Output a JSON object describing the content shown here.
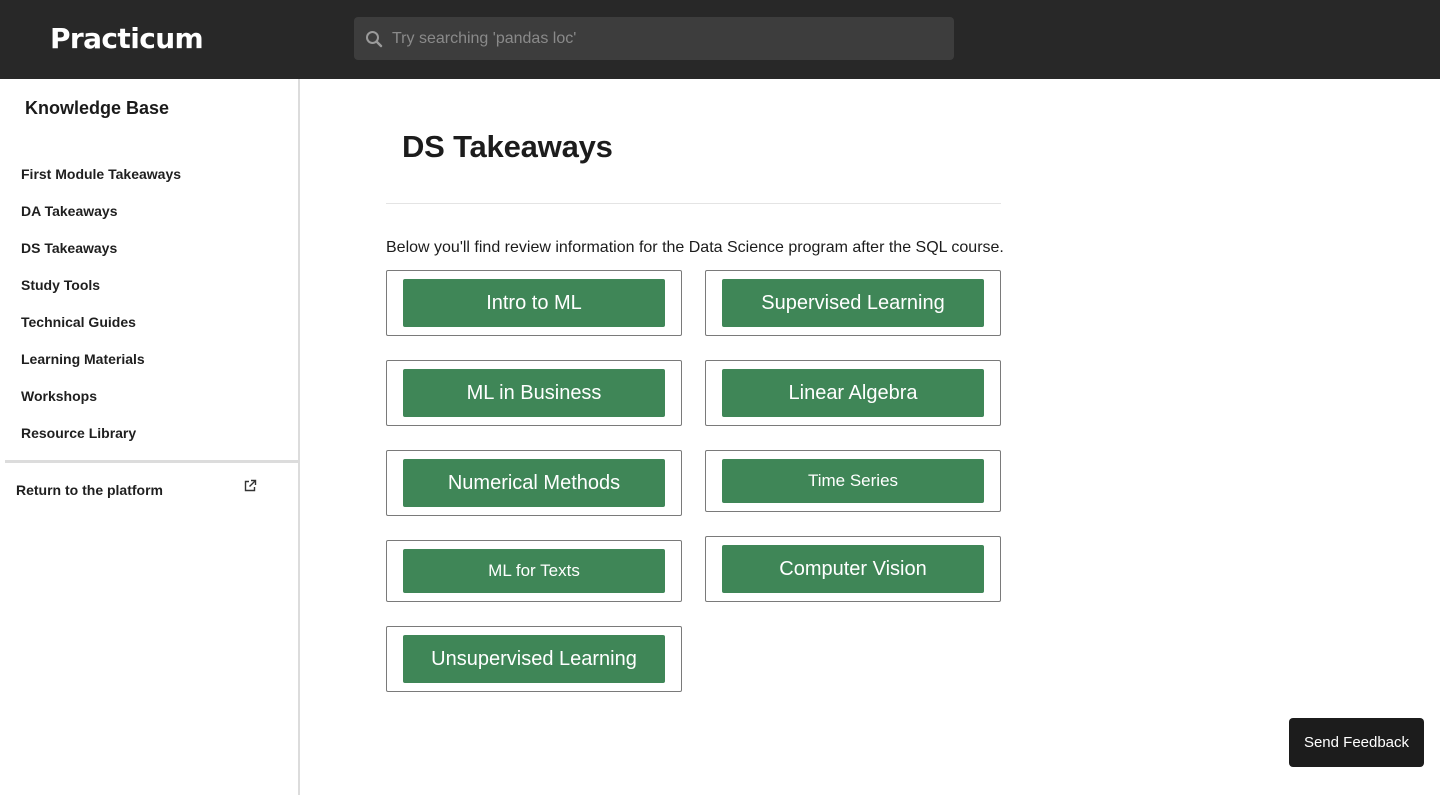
{
  "header": {
    "logo": "Practicum",
    "search_placeholder": "Try searching 'pandas loc'",
    "search_icon": "search-icon"
  },
  "sidebar": {
    "title": "Knowledge Base",
    "items": [
      {
        "label": "First Module Takeaways"
      },
      {
        "label": "DA Takeaways"
      },
      {
        "label": "DS Takeaways"
      },
      {
        "label": "Study Tools"
      },
      {
        "label": "Technical Guides"
      },
      {
        "label": "Learning Materials"
      },
      {
        "label": "Workshops"
      },
      {
        "label": "Resource Library"
      }
    ],
    "return_label": "Return to the platform",
    "return_icon": "external-link-icon"
  },
  "main": {
    "title": "DS Takeaways",
    "intro": "Below you'll find review information for the Data Science program after the SQL course.",
    "cards": [
      {
        "label": "Intro to ML"
      },
      {
        "label": "Supervised Learning"
      },
      {
        "label": "ML in Business"
      },
      {
        "label": "Linear Algebra"
      },
      {
        "label": "Numerical Methods"
      },
      {
        "label": "Time Series"
      },
      {
        "label": "ML for Texts"
      },
      {
        "label": "Computer Vision"
      },
      {
        "label": "Unsupervised Learning"
      }
    ]
  },
  "feedback_label": "Send Feedback",
  "colors": {
    "topbar": "#282828",
    "button_green": "#3f8657",
    "feedback_bg": "#1c1c1c"
  }
}
